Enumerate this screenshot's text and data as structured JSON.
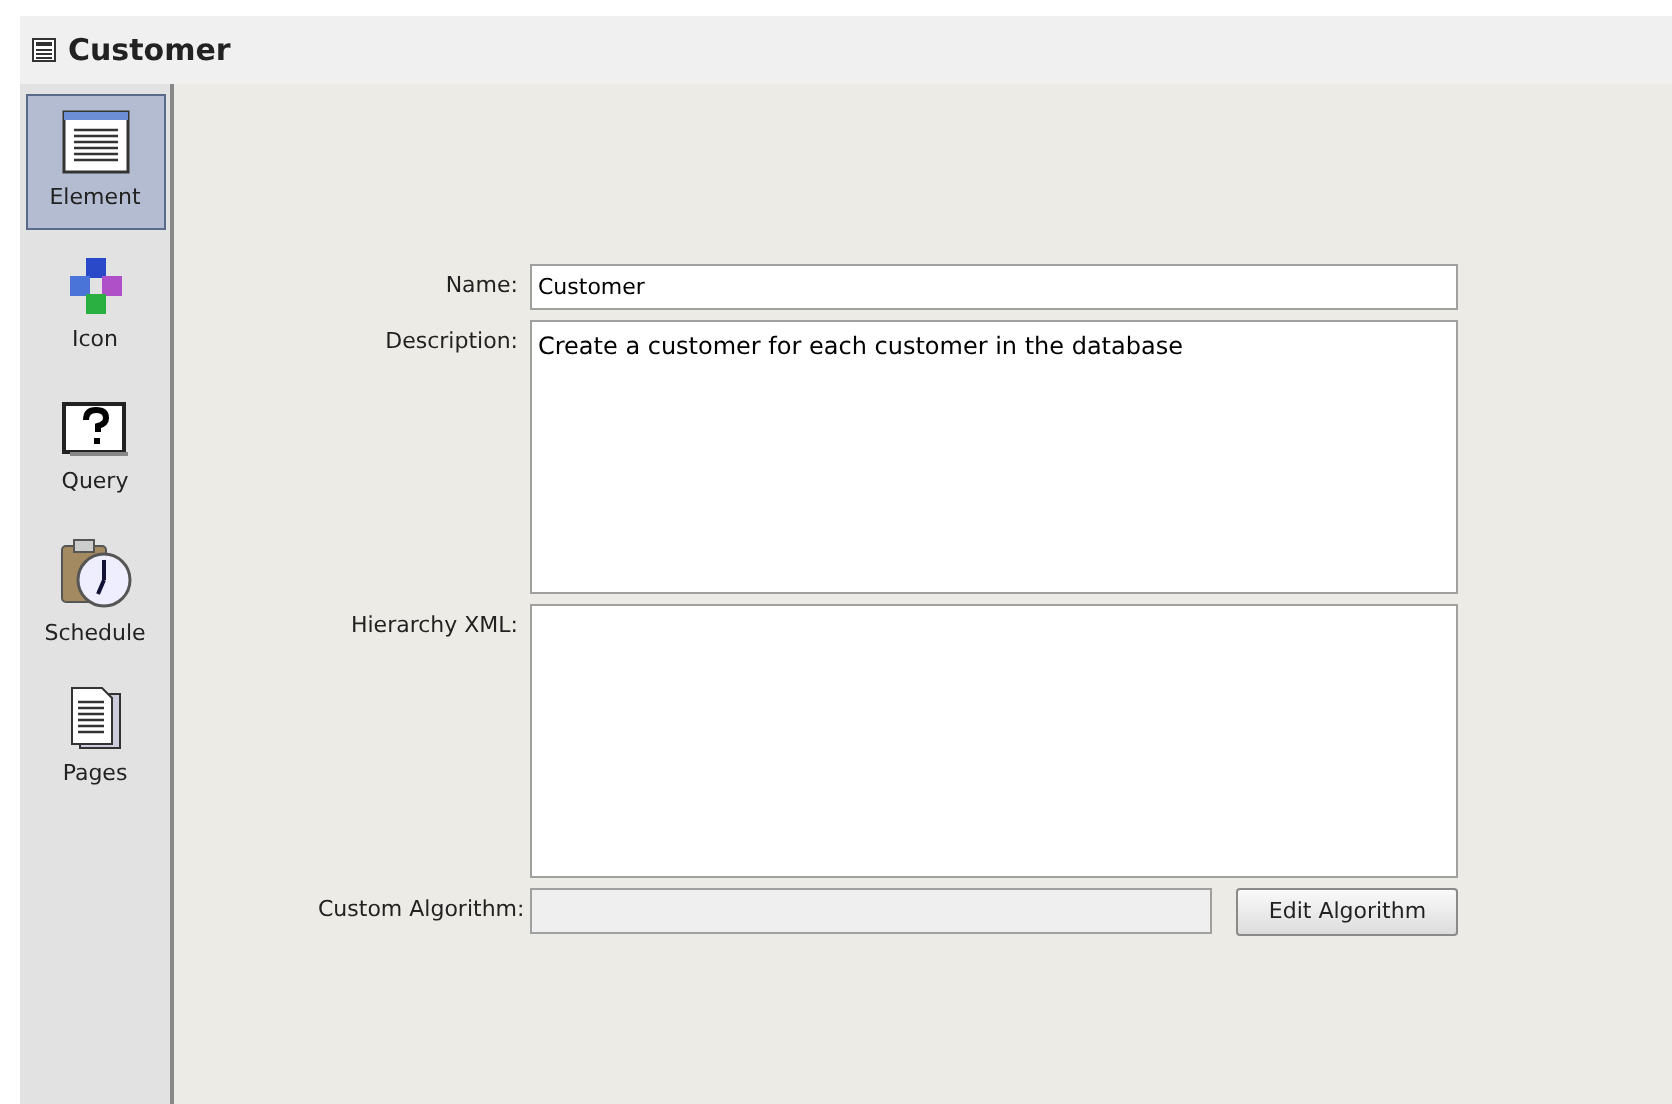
{
  "window": {
    "title": "Customer"
  },
  "sidebar": {
    "items": [
      {
        "label": "Element",
        "kind": "element",
        "selected": true
      },
      {
        "label": "Icon",
        "kind": "icon",
        "selected": false
      },
      {
        "label": "Query",
        "kind": "query",
        "selected": false
      },
      {
        "label": "Schedule",
        "kind": "schedule",
        "selected": false
      },
      {
        "label": "Pages",
        "kind": "pages",
        "selected": false
      }
    ]
  },
  "form": {
    "fields": [
      {
        "label": "Name:",
        "kind": "text",
        "value": "Customer",
        "disabled": false
      },
      {
        "label": "Description:",
        "kind": "area",
        "value": "Create a customer for each customer in the database",
        "disabled": false
      },
      {
        "label": "Hierarchy XML:",
        "kind": "area",
        "disabled": false
      },
      {
        "label": "Custom Algorithm:",
        "kind": "text",
        "disabled": true,
        "button": "Edit Algorithm"
      }
    ]
  }
}
